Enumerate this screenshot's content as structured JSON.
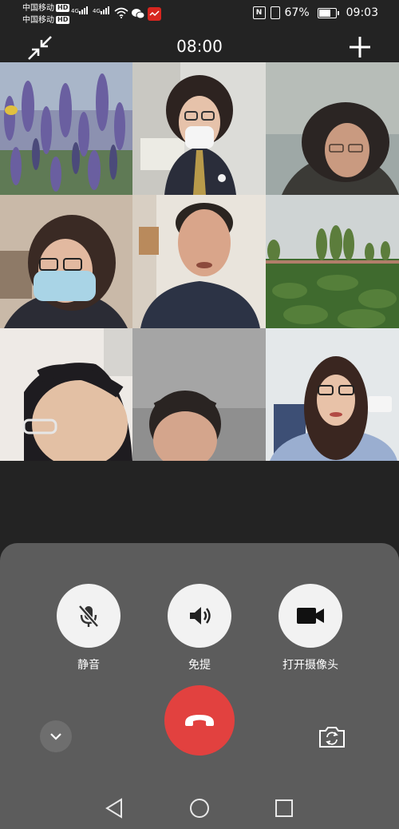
{
  "status_bar": {
    "carrier_1": "中国移动",
    "carrier_2": "中国移动",
    "hd_badge": "HD",
    "network_1": "4G",
    "network_2": "4G",
    "battery_percent": "67%",
    "time": "09:03",
    "icons": [
      "wifi-icon",
      "wechat-icon",
      "app-notification-icon",
      "nfc-icon",
      "vibrate-icon",
      "battery-icon"
    ]
  },
  "call": {
    "duration": "08:00",
    "participant_count": 9
  },
  "controls": {
    "mute_label": "静音",
    "speaker_label": "免提",
    "camera_label": "打开摄像头"
  },
  "colors": {
    "background": "#232323",
    "panel": "#5c5c5c",
    "button": "#f2f2f2",
    "hangup": "#e2413f"
  }
}
